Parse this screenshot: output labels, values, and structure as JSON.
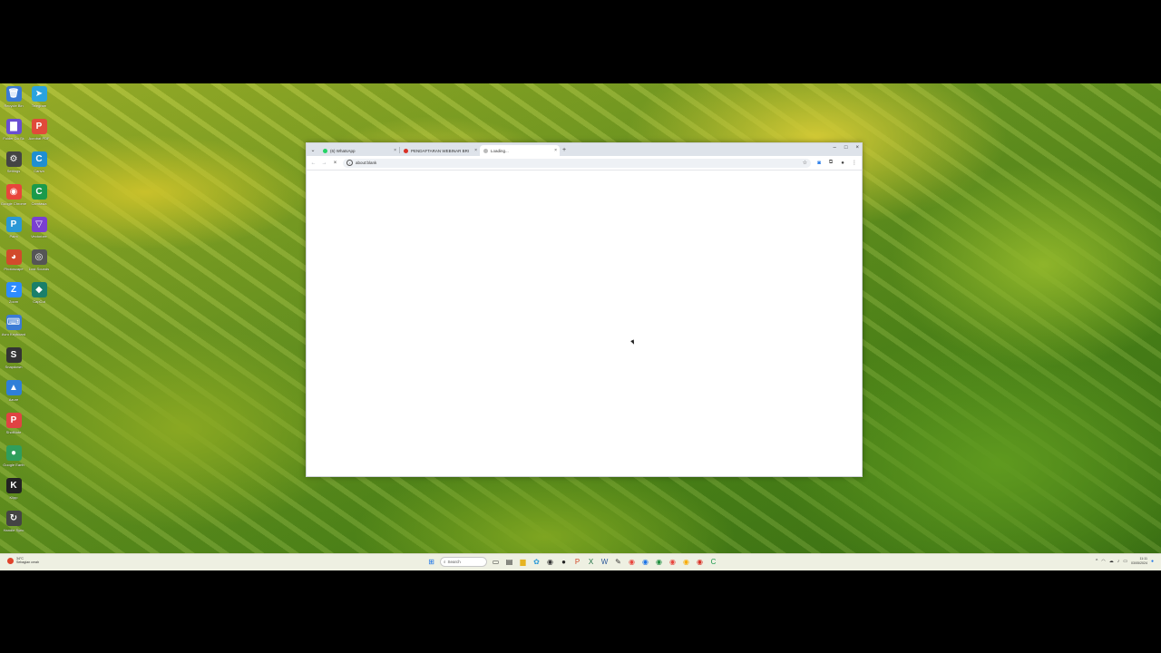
{
  "desktop": {
    "icons": [
      {
        "label": "Recycle Bin",
        "glyph": "🗑",
        "color": "#3a7bd5",
        "col": 0,
        "row": 0
      },
      {
        "label": "Telegram",
        "glyph": "➤",
        "color": "#2aa3df",
        "col": 1,
        "row": 0
      },
      {
        "label": "Folder Do Sk",
        "glyph": "▇",
        "color": "#6a4fd1",
        "col": 0,
        "row": 1
      },
      {
        "label": "Acrobat PDF",
        "glyph": "P",
        "color": "#e04a3a",
        "col": 1,
        "row": 1
      },
      {
        "label": "Settings",
        "glyph": "⚙",
        "color": "#444444",
        "col": 0,
        "row": 2
      },
      {
        "label": "Canva",
        "glyph": "C",
        "color": "#1f8fd1",
        "col": 1,
        "row": 2
      },
      {
        "label": "Google Chrome",
        "glyph": "◉",
        "color": "#e8453c",
        "col": 0,
        "row": 3
      },
      {
        "label": "Camtasia",
        "glyph": "C",
        "color": "#1a9a4b",
        "col": 1,
        "row": 3
      },
      {
        "label": "Paint",
        "glyph": "P",
        "color": "#2a98d6",
        "col": 0,
        "row": 4
      },
      {
        "label": "Vectorizer",
        "glyph": "▽",
        "color": "#7a3fd1",
        "col": 1,
        "row": 4
      },
      {
        "label": "Photoscape",
        "glyph": "◕",
        "color": "#d24a2c",
        "col": 0,
        "row": 5
      },
      {
        "label": "Lost Sounds",
        "glyph": "◎",
        "color": "#555555",
        "col": 1,
        "row": 5
      },
      {
        "label": "Zoom",
        "glyph": "Z",
        "color": "#2d8cff",
        "col": 0,
        "row": 6
      },
      {
        "label": "CapCut",
        "glyph": "◆",
        "color": "#1a7f6a",
        "col": 1,
        "row": 6
      },
      {
        "label": "Avro Keyboard",
        "glyph": "⌨",
        "color": "#3b7bd4",
        "col": 0,
        "row": 7
      },
      {
        "label": "Snapdown",
        "glyph": "S",
        "color": "#333333",
        "col": 0,
        "row": 8
      },
      {
        "label": "Azure",
        "glyph": "▲",
        "color": "#2f7fd8",
        "col": 0,
        "row": 9
      },
      {
        "label": "ShotNote",
        "glyph": "P",
        "color": "#e04343",
        "col": 0,
        "row": 10
      },
      {
        "label": "Google Earth",
        "glyph": "●",
        "color": "#2f9e5c",
        "col": 0,
        "row": 11
      },
      {
        "label": "Klipp",
        "glyph": "K",
        "color": "#222222",
        "col": 0,
        "row": 12
      },
      {
        "label": "Handle Sync",
        "glyph": "↻",
        "color": "#444444",
        "col": 0,
        "row": 13
      }
    ]
  },
  "browser": {
    "tabs": [
      {
        "title": "(6) WhatsApp",
        "favicon_color": "#25d366",
        "active": false
      },
      {
        "title": "PENDAFTARAN WEBINAR BRI",
        "favicon_color": "#d93025",
        "active": false
      },
      {
        "title": "Loading...",
        "favicon_color": "#bbbbbb",
        "active": true
      }
    ],
    "new_tab_label": "+",
    "window_controls": {
      "minimize": "–",
      "maximize": "□",
      "close": "×"
    },
    "toolbar": {
      "back": "←",
      "forward": "→",
      "stop": "×",
      "url": "about:blank",
      "star": "☆"
    }
  },
  "taskbar": {
    "weather": {
      "line1": "34°C",
      "line2": "Sebagian cerah"
    },
    "search_placeholder": "Search",
    "apps": [
      {
        "name": "start-icon",
        "glyph": "⊞",
        "color": "#1a73e8"
      },
      {
        "name": "file-explorer-icon",
        "glyph": "▭",
        "color": "#333333"
      },
      {
        "name": "task-view-icon",
        "glyph": "▤",
        "color": "#222222"
      },
      {
        "name": "folder-icon",
        "glyph": "▆",
        "color": "#e6b422"
      },
      {
        "name": "copilot-icon",
        "glyph": "✿",
        "color": "#2a9ad8"
      },
      {
        "name": "media-icon",
        "glyph": "◉",
        "color": "#333333"
      },
      {
        "name": "obs-icon",
        "glyph": "●",
        "color": "#222222"
      },
      {
        "name": "powerpoint-icon",
        "glyph": "P",
        "color": "#d24726"
      },
      {
        "name": "excel-icon",
        "glyph": "X",
        "color": "#1d6f42"
      },
      {
        "name": "word-icon",
        "glyph": "W",
        "color": "#2b579a"
      },
      {
        "name": "pen-icon",
        "glyph": "✎",
        "color": "#333333"
      },
      {
        "name": "chrome-icon-1",
        "glyph": "◉",
        "color": "#e8453c"
      },
      {
        "name": "chrome-icon-2",
        "glyph": "◉",
        "color": "#1a73e8"
      },
      {
        "name": "chrome-icon-3",
        "glyph": "◉",
        "color": "#1e8e3e"
      },
      {
        "name": "chrome-icon-4",
        "glyph": "◉",
        "color": "#e8453c"
      },
      {
        "name": "chrome-icon-5",
        "glyph": "◉",
        "color": "#f9ab00"
      },
      {
        "name": "chrome-icon-6",
        "glyph": "◉",
        "color": "#d93025"
      },
      {
        "name": "camtasia-icon",
        "glyph": "C",
        "color": "#1a9a4b"
      }
    ],
    "tray": {
      "chevron": "^",
      "clock_time": "11:11",
      "clock_date": "03/05/2024"
    }
  }
}
